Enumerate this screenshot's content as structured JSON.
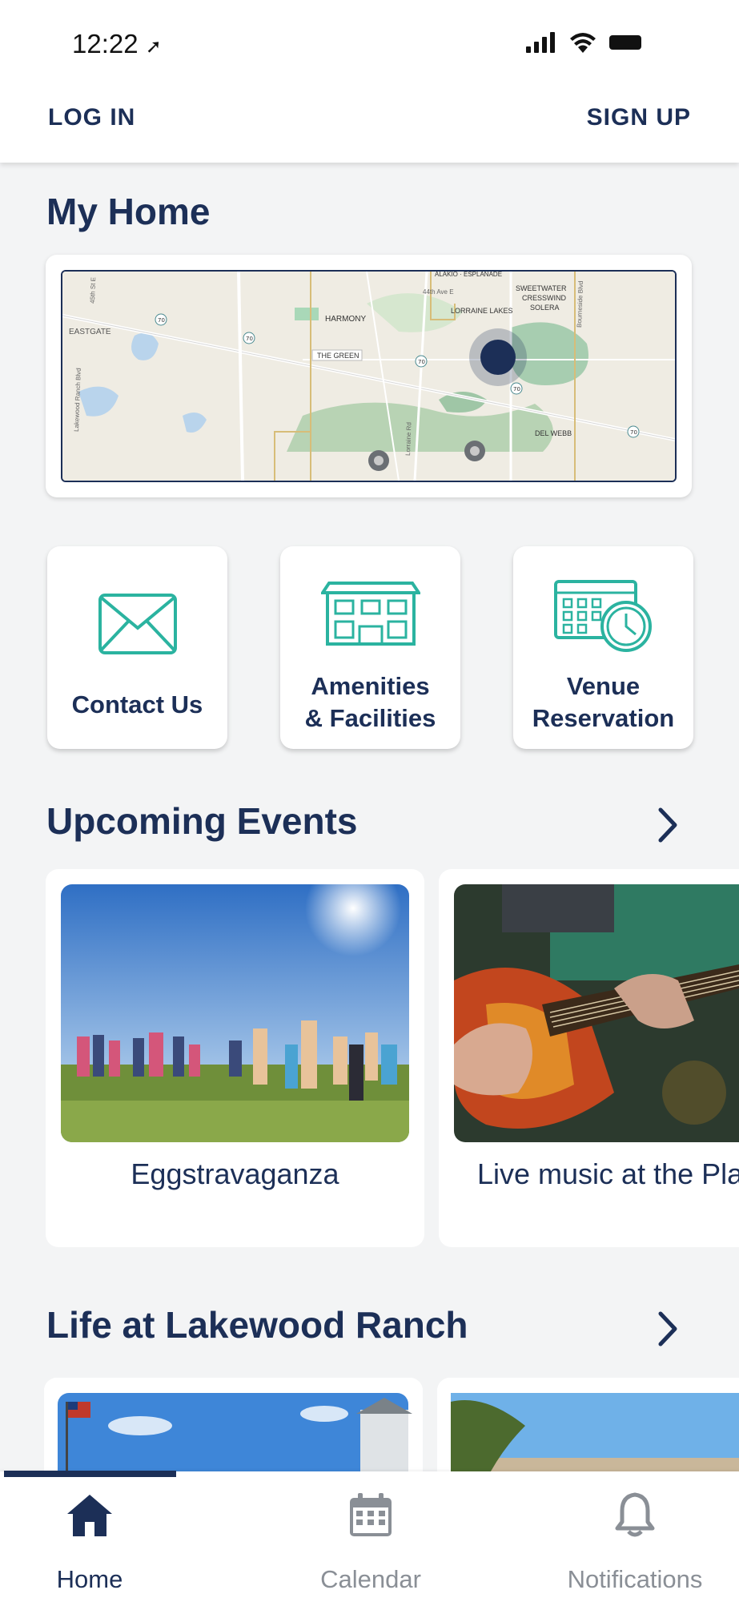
{
  "status": {
    "time": "12:22"
  },
  "topnav": {
    "login": "LOG IN",
    "signup": "SIGN UP"
  },
  "myhome": {
    "title": "My Home"
  },
  "map": {
    "labels": [
      "EASTGATE",
      "HARMONY",
      "THE GREEN",
      "LORRAINE LAKES",
      "SWEETWATER",
      "CRESSWIND",
      "SOLERA",
      "DEL WEBB",
      "ALAKIO · ESPLANADE",
      "44th Ave E",
      "Lorraine Rd",
      "Lakewood Ranch Blvd",
      "45th St E",
      "Bourneside Blvd"
    ],
    "route_badge": "70"
  },
  "tiles": [
    {
      "lines": [
        "Contact Us"
      ],
      "icon": "envelope-icon"
    },
    {
      "lines": [
        "Amenities",
        "& Facilities"
      ],
      "icon": "building-icon"
    },
    {
      "lines": [
        "Venue",
        "Reservation"
      ],
      "icon": "calendar-clock-icon"
    }
  ],
  "events": {
    "title": "Upcoming Events",
    "items": [
      {
        "title": "Eggstravaganza"
      },
      {
        "title": "Live music at the Pla"
      }
    ]
  },
  "life": {
    "title": "Life at Lakewood Ranch"
  },
  "tabs": [
    {
      "label": "Home",
      "icon": "home-icon",
      "active": true
    },
    {
      "label": "Calendar",
      "icon": "calendar-icon",
      "active": false
    },
    {
      "label": "Notifications",
      "icon": "bell-icon",
      "active": false
    }
  ],
  "colors": {
    "navy": "#1c2f57",
    "teal": "#2bb3a0",
    "gray": "#8a8f96",
    "background": "#f3f4f5"
  }
}
